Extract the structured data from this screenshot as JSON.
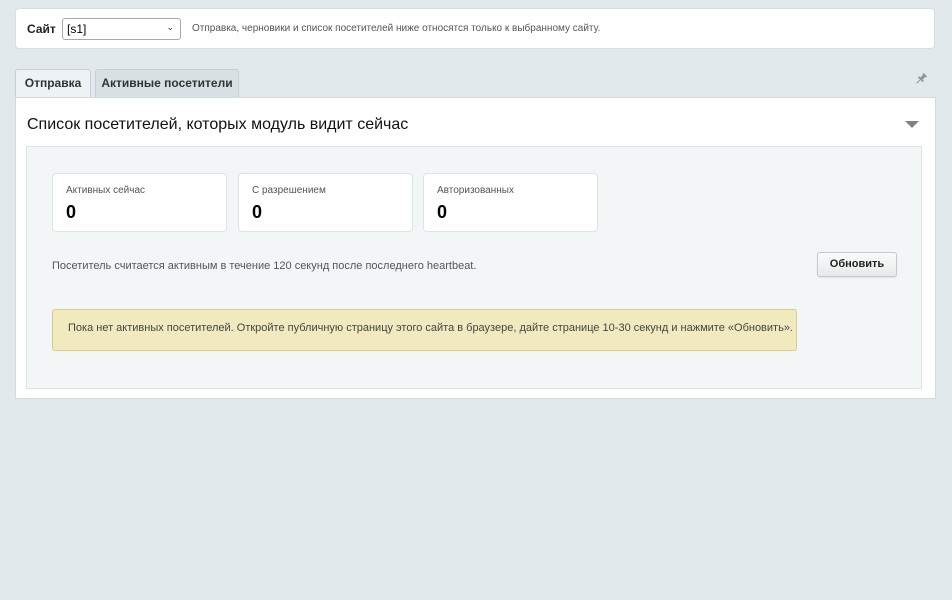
{
  "site_bar": {
    "label": "Сайт",
    "selected_site": "[s1]",
    "hint": "Отправка, черновики и список посетителей ниже относятся только к выбранному сайту."
  },
  "tabs": [
    {
      "label": "Отправка"
    },
    {
      "label": "Активные посетители"
    }
  ],
  "panel": {
    "title": "Список посетителей, которых модуль видит сейчас",
    "stats": [
      {
        "label": "Активных сейчас",
        "value": "0"
      },
      {
        "label": "С разрешением",
        "value": "0"
      },
      {
        "label": "Авторизованных",
        "value": "0"
      }
    ],
    "note": "Посетитель считается активным в течение 120 секунд после последнего heartbeat.",
    "refresh_label": "Обновить",
    "empty_message": "Пока нет активных посетителей. Откройте публичную страницу этого сайта в браузере, дайте странице 10-30 секунд и нажмите «Обновить»."
  },
  "icons": {
    "pin": "pin-icon",
    "collapse": "chevron-down-icon"
  }
}
